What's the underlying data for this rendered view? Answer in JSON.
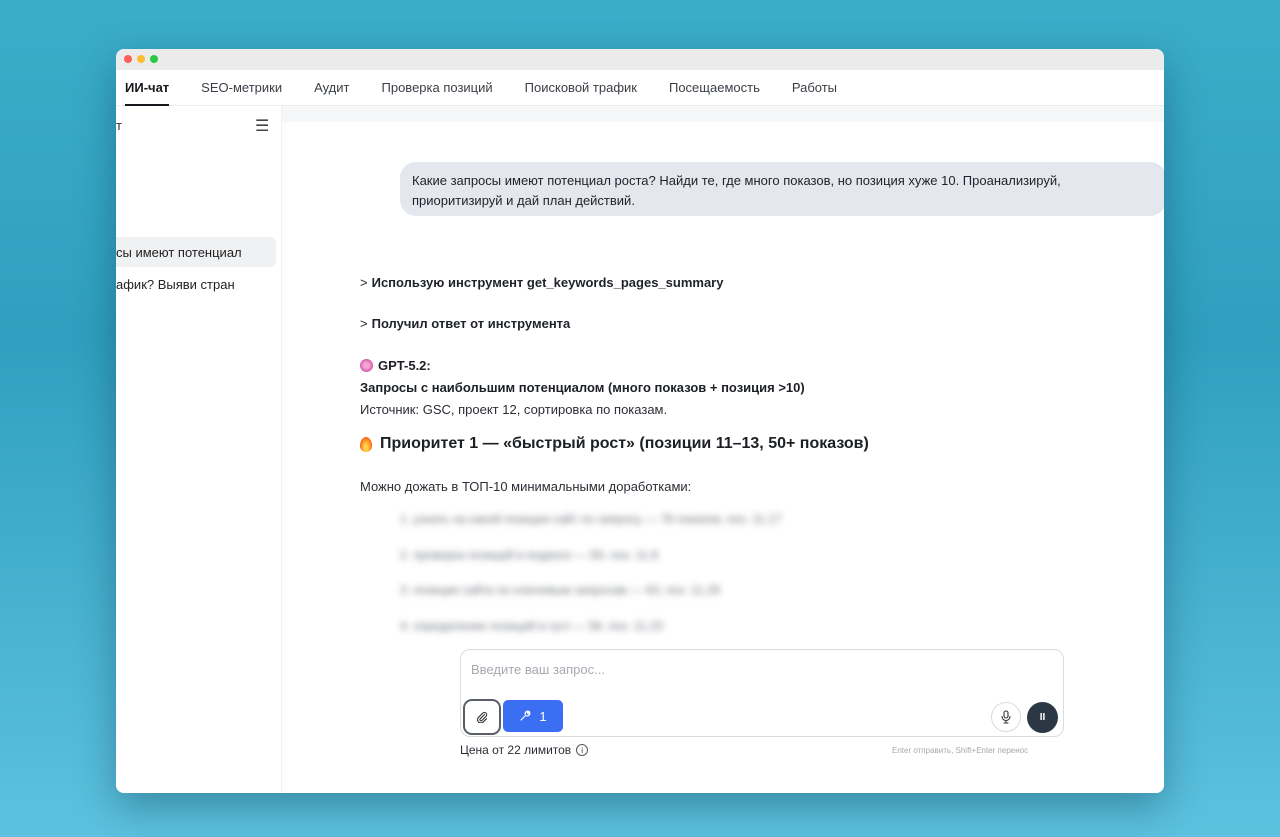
{
  "tabs": [
    {
      "label": "ИИ-чат",
      "active": true
    },
    {
      "label": "SEO-метрики"
    },
    {
      "label": "Аудит"
    },
    {
      "label": "Проверка позиций"
    },
    {
      "label": "Поисковой трафик"
    },
    {
      "label": "Посещаемость"
    },
    {
      "label": "Работы"
    }
  ],
  "sidebar": {
    "title": "т",
    "menu_icon": "☰",
    "items": [
      {
        "label": "сы имеют потенциал"
      },
      {
        "label": "афик? Выяви стран"
      }
    ]
  },
  "chat": {
    "user_message": "Какие запросы имеют потенциал роста? Найди те, где много показов, но позиция хуже 10. Проанализируй, приоритизируй и дай план действий.",
    "tool_call": "Использую инструмент get_keywords_pages_summary",
    "tool_result": "Получил ответ от инструмента",
    "chevron": ">",
    "model_name": "GPT-5.2:",
    "heading": "Запросы с наибольшим потенциалом (много показов + позиция >10)",
    "source": "Источник: GSC, проект 12, сортировка по показам.",
    "priority_title": "Приоритет 1 — «быстрый рост» (позиции 11–13, 50+ показов)",
    "priority_intro": "Можно дожать в ТОП-10 минимальными доработками:",
    "blurred_items": [
      "1. узнать на какой позиции сайт по запросу — 76 показов, поз. 11.17",
      "2. проверка позиций в яндексе — 60, поз. 11.8",
      "3. позиции сайта по ключевым запросам — 63, поз. 11.29",
      "4. определение позиций в гугл — 56, поз. 11.23"
    ]
  },
  "composer": {
    "placeholder": "Введите ваш запрос...",
    "tools_count": "1",
    "price_text": "Цена от 22 лимитов",
    "hint": "Enter отправить, Shift+Enter перенос",
    "stop_label": "II",
    "info_label": "i"
  },
  "colors": {
    "accent": "#3a6ff4",
    "user_bubble": "#e4e7ee",
    "stop_button": "#2c3745"
  }
}
